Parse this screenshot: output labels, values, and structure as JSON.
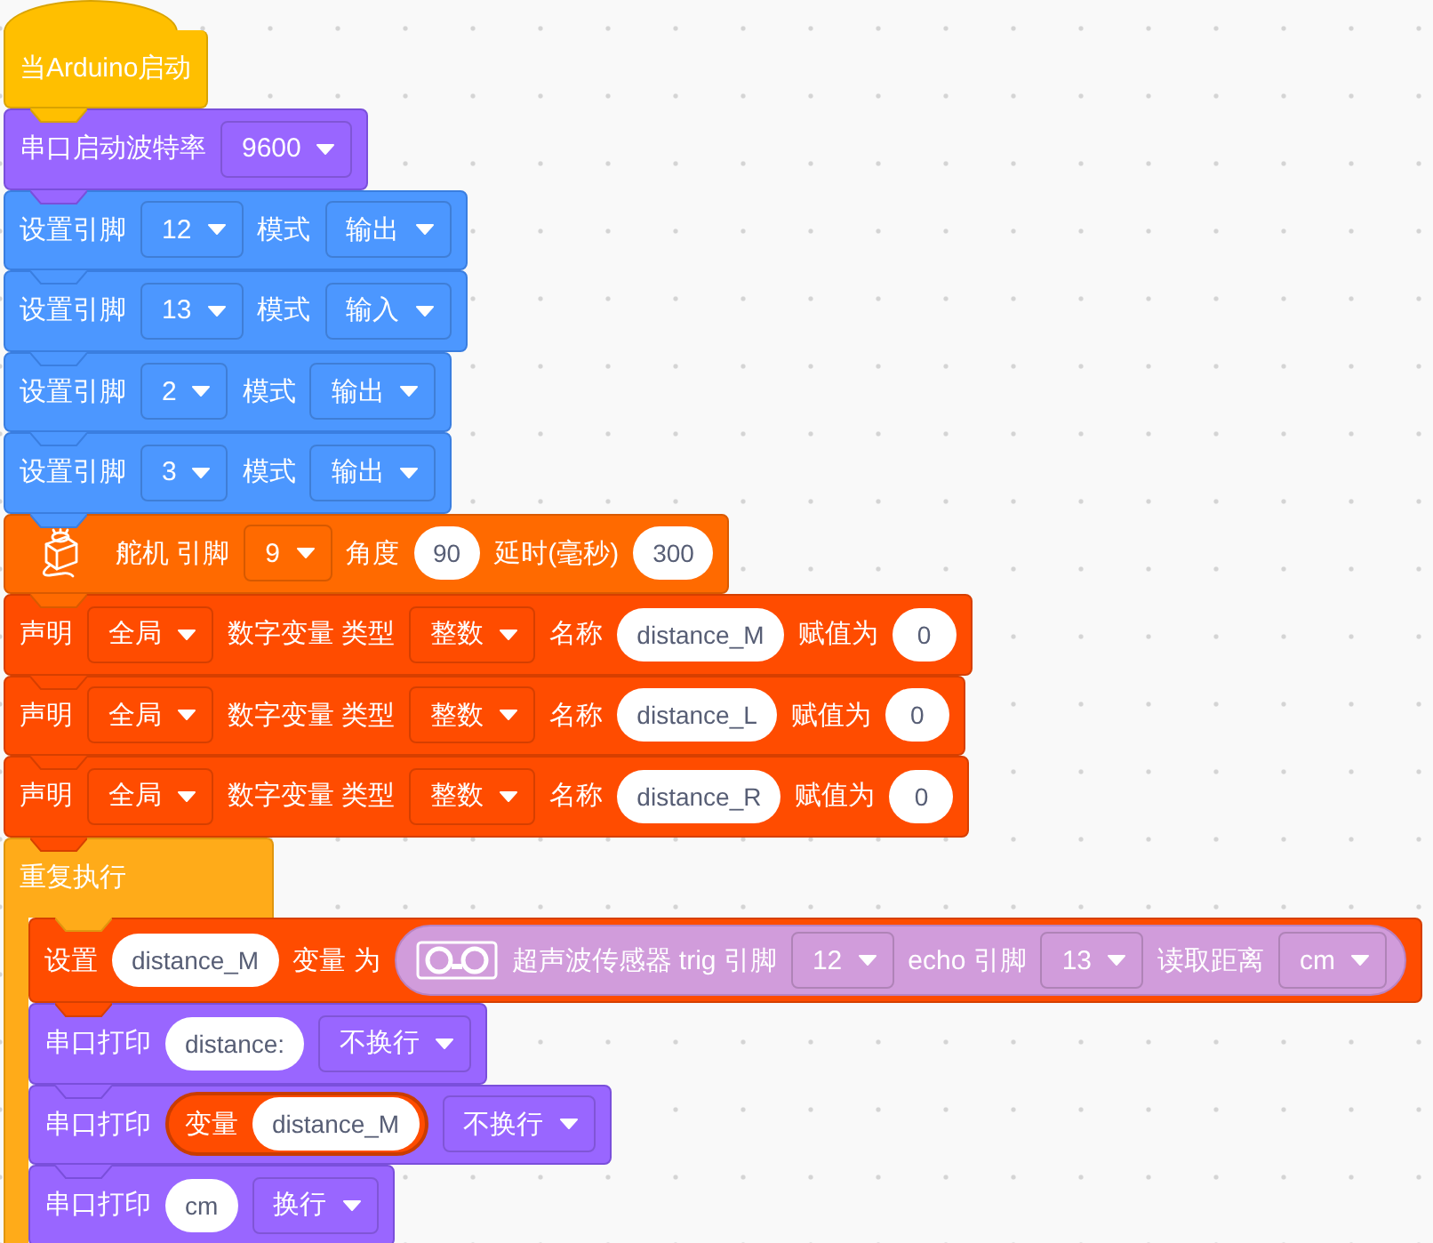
{
  "script": [
    {
      "kind": "hat",
      "parts": [
        {
          "kind": "label",
          "text": "当Arduino启动"
        }
      ]
    },
    {
      "kind": "serial",
      "parts": [
        {
          "kind": "label",
          "text": "串口启动波特率"
        },
        {
          "kind": "dropdown",
          "text": "9600"
        }
      ]
    },
    {
      "kind": "pin",
      "parts": [
        {
          "kind": "label",
          "text": "设置引脚"
        },
        {
          "kind": "dropdown",
          "text": "12"
        },
        {
          "kind": "label",
          "text": "模式"
        },
        {
          "kind": "dropdown",
          "text": "输出"
        }
      ]
    },
    {
      "kind": "pin",
      "parts": [
        {
          "kind": "label",
          "text": "设置引脚"
        },
        {
          "kind": "dropdown",
          "text": "13"
        },
        {
          "kind": "label",
          "text": "模式"
        },
        {
          "kind": "dropdown",
          "text": "输入"
        }
      ]
    },
    {
      "kind": "pin",
      "parts": [
        {
          "kind": "label",
          "text": "设置引脚"
        },
        {
          "kind": "dropdown",
          "text": "2"
        },
        {
          "kind": "label",
          "text": "模式"
        },
        {
          "kind": "dropdown",
          "text": "输出"
        }
      ]
    },
    {
      "kind": "pin",
      "parts": [
        {
          "kind": "label",
          "text": "设置引脚"
        },
        {
          "kind": "dropdown",
          "text": "3"
        },
        {
          "kind": "label",
          "text": "模式"
        },
        {
          "kind": "dropdown",
          "text": "输出"
        }
      ]
    },
    {
      "kind": "servo",
      "parts": [
        {
          "kind": "label",
          "text": "舵机 引脚"
        },
        {
          "kind": "dropdown",
          "text": "9"
        },
        {
          "kind": "label",
          "text": "角度"
        },
        {
          "kind": "input",
          "text": "90"
        },
        {
          "kind": "label",
          "text": "延时(毫秒)"
        },
        {
          "kind": "input",
          "text": "300"
        }
      ]
    },
    {
      "kind": "variable",
      "parts": [
        {
          "kind": "label",
          "text": "声明"
        },
        {
          "kind": "dropdown",
          "text": "全局"
        },
        {
          "kind": "label",
          "text": "数字变量 类型"
        },
        {
          "kind": "dropdown",
          "text": "整数"
        },
        {
          "kind": "label",
          "text": "名称"
        },
        {
          "kind": "input",
          "text": "distance_M"
        },
        {
          "kind": "label",
          "text": "赋值为"
        },
        {
          "kind": "input",
          "text": "0"
        }
      ]
    },
    {
      "kind": "variable",
      "parts": [
        {
          "kind": "label",
          "text": "声明"
        },
        {
          "kind": "dropdown",
          "text": "全局"
        },
        {
          "kind": "label",
          "text": "数字变量 类型"
        },
        {
          "kind": "dropdown",
          "text": "整数"
        },
        {
          "kind": "label",
          "text": "名称"
        },
        {
          "kind": "input",
          "text": "distance_L"
        },
        {
          "kind": "label",
          "text": "赋值为"
        },
        {
          "kind": "input",
          "text": "0"
        }
      ]
    },
    {
      "kind": "variable",
      "parts": [
        {
          "kind": "label",
          "text": "声明"
        },
        {
          "kind": "dropdown",
          "text": "全局"
        },
        {
          "kind": "label",
          "text": "数字变量 类型"
        },
        {
          "kind": "dropdown",
          "text": "整数"
        },
        {
          "kind": "label",
          "text": "名称"
        },
        {
          "kind": "input",
          "text": "distance_R"
        },
        {
          "kind": "label",
          "text": "赋值为"
        },
        {
          "kind": "input",
          "text": "0"
        }
      ]
    },
    {
      "kind": "loop",
      "parts": [
        {
          "kind": "label",
          "text": "重复执行"
        }
      ],
      "children": [
        {
          "kind": "variable",
          "parts": [
            {
              "kind": "label",
              "text": "设置"
            },
            {
              "kind": "input",
              "text": "distance_M"
            },
            {
              "kind": "label",
              "text": "变量 为"
            },
            {
              "kind": "ultrasonic",
              "parts": [
                {
                  "kind": "label",
                  "text": "超声波传感器 trig 引脚"
                },
                {
                  "kind": "dropdown",
                  "text": "12"
                },
                {
                  "kind": "label",
                  "text": "echo 引脚"
                },
                {
                  "kind": "dropdown",
                  "text": "13"
                },
                {
                  "kind": "label",
                  "text": "读取距离"
                },
                {
                  "kind": "dropdown",
                  "text": "cm"
                }
              ]
            }
          ]
        },
        {
          "kind": "serial",
          "parts": [
            {
              "kind": "label",
              "text": "串口打印"
            },
            {
              "kind": "input",
              "text": "distance:"
            },
            {
              "kind": "dropdown",
              "text": "不换行"
            }
          ]
        },
        {
          "kind": "serial",
          "parts": [
            {
              "kind": "label",
              "text": "串口打印"
            },
            {
              "kind": "variable",
              "parts": [
                {
                  "kind": "label",
                  "text": "变量"
                },
                {
                  "kind": "input",
                  "text": "distance_M"
                }
              ]
            },
            {
              "kind": "dropdown",
              "text": "不换行"
            }
          ]
        },
        {
          "kind": "serial",
          "parts": [
            {
              "kind": "label",
              "text": "串口打印"
            },
            {
              "kind": "input",
              "text": "cm"
            },
            {
              "kind": "dropdown",
              "text": "换行"
            }
          ]
        }
      ]
    }
  ]
}
